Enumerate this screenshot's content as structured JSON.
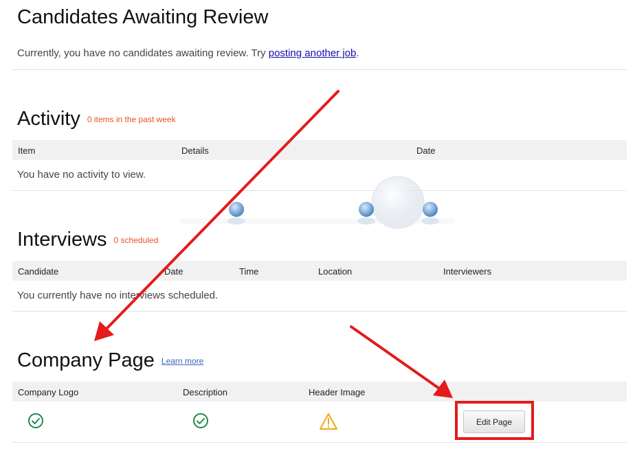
{
  "review": {
    "title": "Candidates Awaiting Review",
    "message_prefix": "Currently, you have no candidates awaiting review. Try ",
    "link_text": "posting another job",
    "message_suffix": "."
  },
  "activity": {
    "title": "Activity",
    "count": "0 items in the past week",
    "columns": [
      "Item",
      "Details",
      "Date"
    ],
    "empty": "You have no activity to view."
  },
  "interviews": {
    "title": "Interviews",
    "count": "0 scheduled",
    "columns": [
      "Candidate",
      "Date",
      "Time",
      "Location",
      "Interviewers"
    ],
    "empty": "You currently have no interviews scheduled."
  },
  "company": {
    "title": "Company Page",
    "learn_more": "Learn more",
    "columns": [
      "Company Logo",
      "Description",
      "Header Image"
    ],
    "statuses": [
      "complete",
      "complete",
      "warning"
    ],
    "edit_button": "Edit Page"
  },
  "colors": {
    "accent_orange": "#e8541e",
    "check_green": "#1e8a4c",
    "warning_amber": "#f0a81c",
    "annotation_red": "#e31b1b"
  },
  "icons": [
    "check-circle-icon",
    "warning-triangle-icon",
    "arrow-annotation-icon",
    "logo-watermark-icon"
  ]
}
